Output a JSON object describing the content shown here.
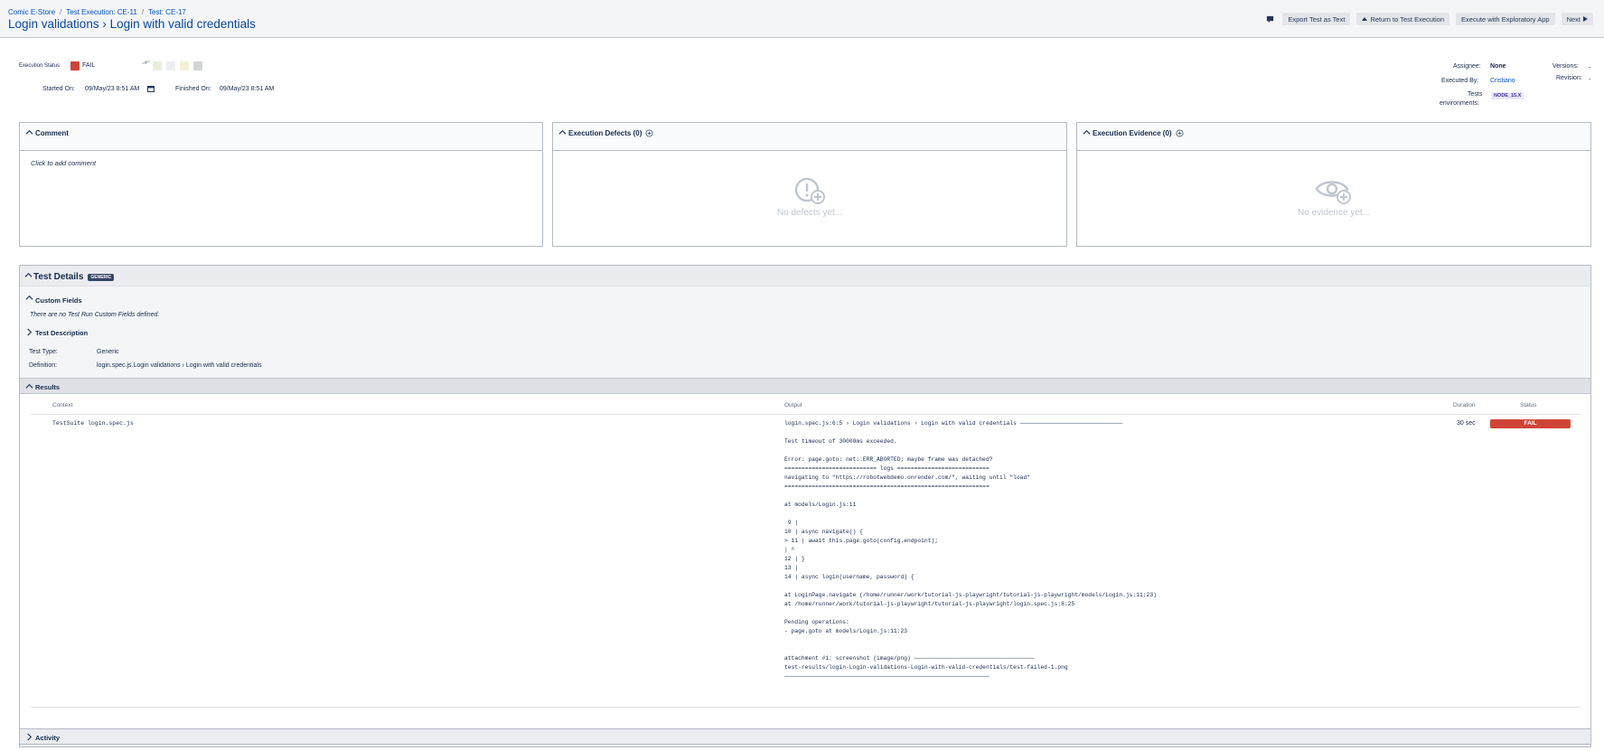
{
  "breadcrumb": {
    "project": "Comic E-Store",
    "execution": "Test Execution: CE-11",
    "test": "Test: CE-17",
    "separator": "/"
  },
  "page_title": "Login validations › Login with valid credentials",
  "toolbar": {
    "export_label": "Export Test as Text",
    "return_label": "Return to Test Execution",
    "exploratory_label": "Execute with Exploratory App",
    "next_label": "Next"
  },
  "execution": {
    "status_label": "Execution Status",
    "status_value": "FAIL",
    "status_color": "#d04437",
    "started_label": "Started On:",
    "started_value": "09/May/23 8:51 AM",
    "finished_label": "Finished On:",
    "finished_value": "09/May/23 8:51 AM"
  },
  "meta": {
    "assignee_label": "Assignee:",
    "assignee_value": "None",
    "executed_by_label": "Executed By:",
    "executed_by_value": "Cristiano",
    "env_label_1": "Tests",
    "env_label_2": "environments:",
    "env_value": "NODE_15.X",
    "versions_label": "Versions:",
    "versions_value": "-",
    "revision_label": "Revision:",
    "revision_value": "-"
  },
  "panels": {
    "comment_title": "Comment",
    "comment_placeholder": "Click to add comment",
    "defects_title": "Execution Defects (0)",
    "defects_empty": "No defects yet...",
    "evidence_title": "Execution Evidence (0)",
    "evidence_empty": "No evidence yet..."
  },
  "details": {
    "title": "Test Details",
    "badge": "GENERIC",
    "custom_fields_title": "Custom Fields",
    "custom_fields_note": "There are no Test Run Custom Fields defined.",
    "description_title": "Test Description",
    "type_label": "Test Type:",
    "type_value": "Generic",
    "definition_label": "Definition:",
    "definition_value": "login.spec.js.Login validations › Login with valid credentials"
  },
  "results": {
    "title": "Results",
    "col_context": "Context",
    "col_output": "Output",
    "col_duration": "Duration",
    "col_status": "Status",
    "row_context": "TestSuite login.spec.js",
    "row_duration": "30 sec",
    "row_status": "FAIL",
    "row_output": "login.spec.js:6:5 › Login validations › Login with valid credentials ──────────────────────────────\n\nTest timeout of 30000ms exceeded.\n\nError: page.goto: net::ERR_ABORTED; maybe frame was detached?\n=========================== logs ===========================\nnavigating to \"https://robotwebdemo.onrender.com/\", waiting until \"load\"\n============================================================\n\nat models/Login.js:11\n\n 9 |\n10 | async navigate() {\n> 11 | await this.page.goto(config.endpoint);\n| ^\n12 | }\n13 |\n14 | async login(username, password) {\n\nat LoginPage.navigate (/home/runner/work/tutorial-js-playwright/tutorial-js-playwright/models/Login.js:11:23)\nat /home/runner/work/tutorial-js-playwright/tutorial-js-playwright/login.spec.js:8:25\n\nPending operations:\n- page.goto at models/Login.js:11:23\n\n\nattachment #1: screenshot (image/png) ───────────────────────────────────\ntest-results/login-Login-validations-Login-with-valid-credentials/test-failed-1.png\n────────────────────────────────────────────────────────────"
  },
  "activity": {
    "title": "Activity"
  },
  "icons": {
    "feedback": "feedback-icon",
    "calendar": "calendar-icon",
    "chevron": "chevron-up-icon",
    "add": "add-circle-icon"
  }
}
